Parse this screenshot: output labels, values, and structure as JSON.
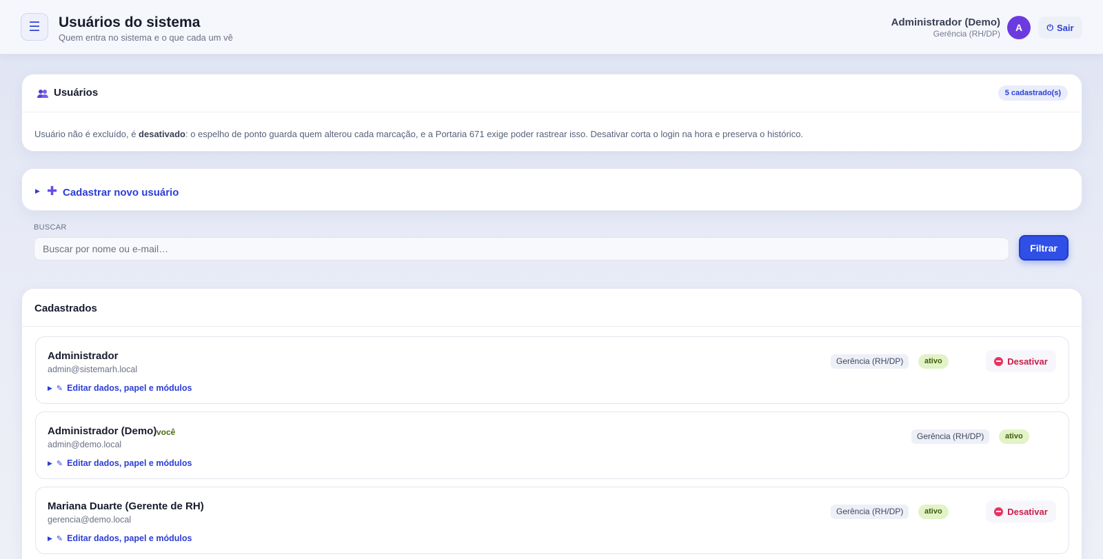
{
  "header": {
    "menu_icon": "hamburger-icon",
    "title": "Usuários do sistema",
    "subtitle": "Quem entra no sistema e o que cada um vê",
    "user_name": "Administrador (Demo)",
    "user_role": "Gerência (RH/DP)",
    "avatar_letter": "A",
    "logout_label": "Sair"
  },
  "users_card": {
    "title": "Usuários",
    "icon": "users-icon",
    "count_badge": "5 cadastrado(s)",
    "info_prefix": "Usuário não é excluído, é ",
    "info_bold": "desativado",
    "info_suffix": ": o espelho de ponto guarda quem alterou cada marcação, e a Portaria 671 exige poder rastrear isso. Desativar corta o login na hora e preserva o histórico."
  },
  "new_user": {
    "label": "Cadastrar novo usuário"
  },
  "search": {
    "label": "BUSCAR",
    "placeholder": "Buscar por nome ou e-mail…",
    "value": "",
    "filter_label": "Filtrar"
  },
  "list": {
    "title": "Cadastrados",
    "edit_label": "Editar dados, papel e módulos",
    "deactivate_label": "Desativar",
    "rows": [
      {
        "name": "Administrador",
        "email": "admin@sistemarh.local",
        "you": "",
        "role": "Gerência (RH/DP)",
        "status": "ativo",
        "can_deactivate": true
      },
      {
        "name": "Administrador (Demo)",
        "email": "admin@demo.local",
        "you": "você",
        "role": "Gerência (RH/DP)",
        "status": "ativo",
        "can_deactivate": false
      },
      {
        "name": "Mariana Duarte (Gerente de RH)",
        "email": "gerencia@demo.local",
        "you": "",
        "role": "Gerência (RH/DP)",
        "status": "ativo",
        "can_deactivate": true
      }
    ]
  },
  "colors": {
    "accent": "#2f4fe6",
    "avatar": "#6b3be0",
    "danger": "#c81d4a",
    "status_bg": "#e2f3c7"
  }
}
